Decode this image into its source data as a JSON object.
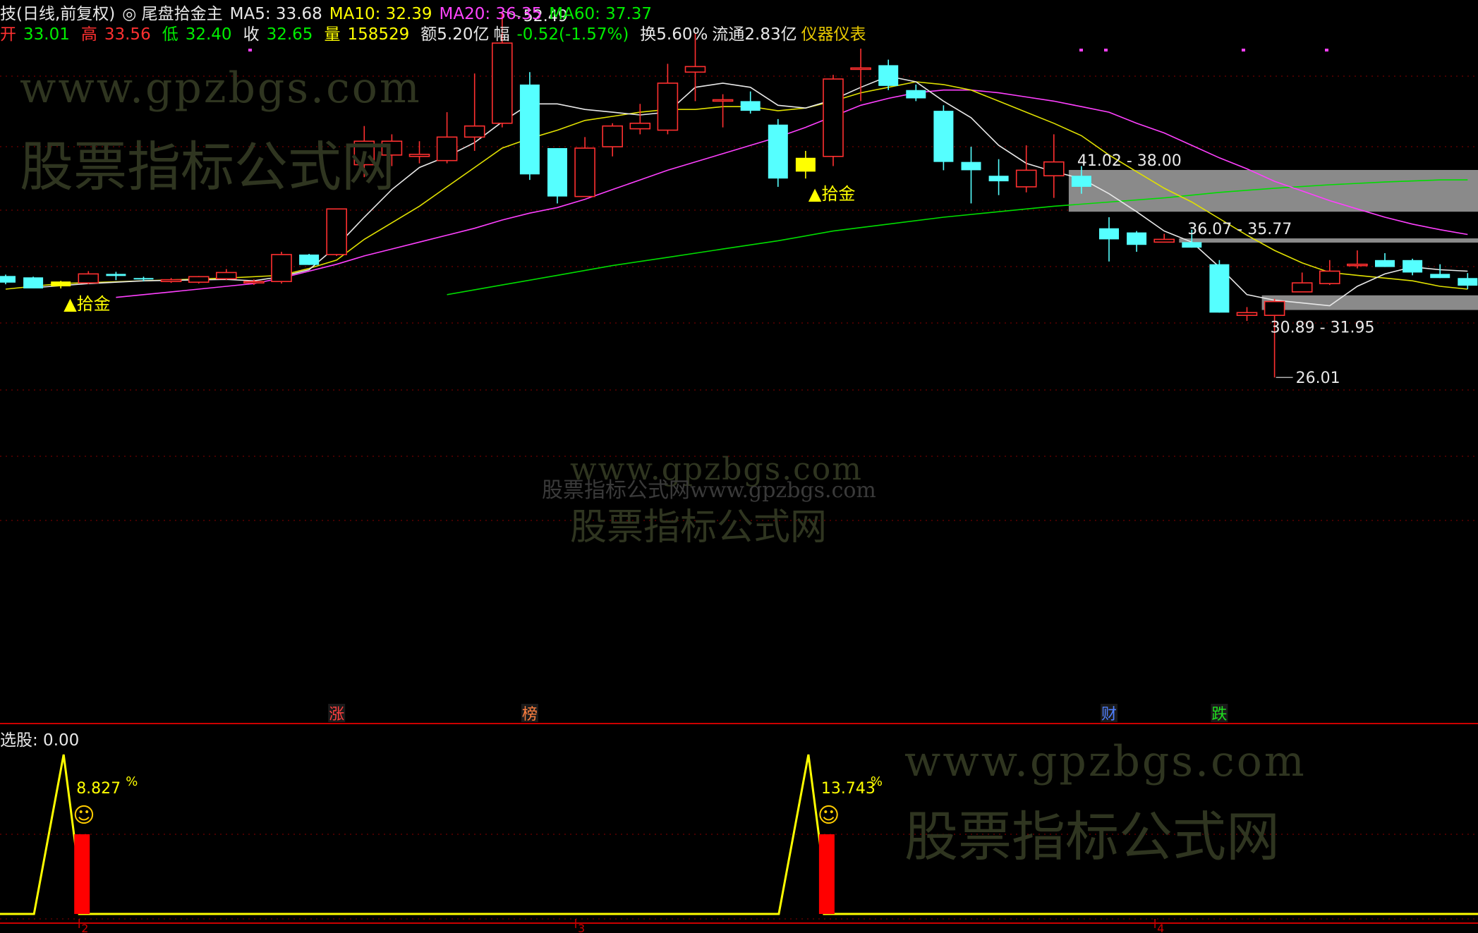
{
  "header": {
    "title_prefix": "技(日线,前复权)",
    "indicator_name": "尾盘拾金主",
    "ma5": "MA5: 33.68",
    "ma10": "MA10: 32.39",
    "ma20": "MA20: 36.35",
    "ma60": "MA60: 37.37",
    "open_label": "开",
    "open": "33.01",
    "high_label": "高",
    "high": "33.56",
    "low_label": "低",
    "low": "32.40",
    "close_label": "收",
    "close": "32.65",
    "vol_label": "量",
    "vol": "158529",
    "amount": "额5.20亿",
    "change_label": "幅",
    "change": "-0.52(-1.57%)",
    "turnover": "换5.60%",
    "float_cap": "流通2.83亿",
    "sector": "仪器仪表"
  },
  "sub_panel": {
    "label": "选股: 0.00"
  },
  "watermarks": {
    "url": "www.gpzbgs.com",
    "name": "股票指标公式网",
    "combined": "股票指标公式网www.gpzbgs.com"
  },
  "colors": {
    "up": "#ff3030",
    "down": "#55ffff",
    "signal": "#ffff00",
    "ma5": "#e8e8e8",
    "ma10": "#e0e000",
    "ma20": "#ff40ff",
    "ma60": "#00dd00",
    "grid": "#8b0000",
    "zone": "#8a8a8a"
  },
  "chart_data": {
    "type": "candlestick",
    "price_axis_visible": false,
    "grid": "dotted-horizontal",
    "candles": [
      {
        "o": 33.35,
        "h": 33.45,
        "l": 32.75,
        "c": 32.87
      },
      {
        "o": 33.25,
        "h": 33.3,
        "l": 32.45,
        "c": 32.45
      },
      {
        "o": 32.6,
        "h": 33.0,
        "l": 32.45,
        "c": 32.95,
        "signal": true
      },
      {
        "o": 32.85,
        "h": 33.7,
        "l": 32.75,
        "c": 33.5
      },
      {
        "o": 33.5,
        "h": 33.65,
        "l": 33.05,
        "c": 33.35
      },
      {
        "o": 33.2,
        "h": 33.3,
        "l": 32.95,
        "c": 33.15
      },
      {
        "o": 32.95,
        "h": 33.2,
        "l": 32.85,
        "c": 33.08
      },
      {
        "o": 32.9,
        "h": 33.35,
        "l": 32.8,
        "c": 33.3
      },
      {
        "o": 33.15,
        "h": 33.85,
        "l": 33.05,
        "c": 33.6
      },
      {
        "o": 32.87,
        "h": 33.1,
        "l": 32.7,
        "c": 32.95
      },
      {
        "o": 32.95,
        "h": 35.1,
        "l": 32.8,
        "c": 34.9
      },
      {
        "o": 34.9,
        "h": 34.95,
        "l": 34.15,
        "c": 34.15
      },
      {
        "o": 34.9,
        "h": 38.2,
        "l": 34.8,
        "c": 38.2
      },
      {
        "o": 41.4,
        "h": 44.2,
        "l": 40.5,
        "c": 43.1
      },
      {
        "o": 42.1,
        "h": 43.6,
        "l": 41.3,
        "c": 43.1
      },
      {
        "o": 42.0,
        "h": 43.1,
        "l": 41.5,
        "c": 42.15
      },
      {
        "o": 41.7,
        "h": 45.2,
        "l": 41.5,
        "c": 43.4
      },
      {
        "o": 43.4,
        "h": 48.0,
        "l": 42.4,
        "c": 44.2
      },
      {
        "o": 44.4,
        "h": 52.49,
        "l": 44.1,
        "c": 50.2
      },
      {
        "o": 47.2,
        "h": 48.1,
        "l": 40.3,
        "c": 40.7
      },
      {
        "o": 42.6,
        "h": 42.6,
        "l": 38.6,
        "c": 39.1
      },
      {
        "o": 39.1,
        "h": 43.4,
        "l": 39.1,
        "c": 42.6
      },
      {
        "o": 42.7,
        "h": 44.4,
        "l": 42.0,
        "c": 44.2
      },
      {
        "o": 44.0,
        "h": 45.8,
        "l": 43.6,
        "c": 44.4
      },
      {
        "o": 43.9,
        "h": 48.7,
        "l": 43.6,
        "c": 47.3
      },
      {
        "o": 48.1,
        "h": 50.9,
        "l": 46.0,
        "c": 48.5
      },
      {
        "o": 46.1,
        "h": 46.5,
        "l": 44.1,
        "c": 46.1
      },
      {
        "o": 46.0,
        "h": 46.7,
        "l": 45.1,
        "c": 45.3
      },
      {
        "o": 44.3,
        "h": 44.7,
        "l": 39.8,
        "c": 40.4
      },
      {
        "o": 40.9,
        "h": 42.4,
        "l": 40.4,
        "c": 41.9,
        "signal": true
      },
      {
        "o": 42.0,
        "h": 47.9,
        "l": 41.3,
        "c": 47.6
      },
      {
        "o": 48.4,
        "h": 49.8,
        "l": 46.0,
        "c": 48.4
      },
      {
        "o": 48.6,
        "h": 49.0,
        "l": 46.8,
        "c": 47.1
      },
      {
        "o": 46.8,
        "h": 47.2,
        "l": 46.0,
        "c": 46.2
      },
      {
        "o": 45.3,
        "h": 45.7,
        "l": 41.0,
        "c": 41.6
      },
      {
        "o": 41.6,
        "h": 42.7,
        "l": 38.6,
        "c": 41.0
      },
      {
        "o": 40.6,
        "h": 41.8,
        "l": 39.2,
        "c": 40.2
      },
      {
        "o": 39.8,
        "h": 42.8,
        "l": 39.4,
        "c": 41.0
      },
      {
        "o": 40.6,
        "h": 43.6,
        "l": 39.0,
        "c": 41.6
      },
      {
        "o": 40.6,
        "h": 41.3,
        "l": 39.3,
        "c": 39.8
      },
      {
        "o": 36.8,
        "h": 37.6,
        "l": 34.4,
        "c": 36.0
      },
      {
        "o": 36.5,
        "h": 36.6,
        "l": 35.1,
        "c": 35.6
      },
      {
        "o": 35.8,
        "h": 36.4,
        "l": 35.8,
        "c": 36.0
      },
      {
        "o": 35.8,
        "h": 36.7,
        "l": 35.4,
        "c": 35.4
      },
      {
        "o": 34.2,
        "h": 34.5,
        "l": 30.7,
        "c": 30.7
      },
      {
        "o": 30.5,
        "h": 31.1,
        "l": 30.1,
        "c": 30.7
      },
      {
        "o": 30.5,
        "h": 31.7,
        "l": 26.01,
        "c": 31.5
      },
      {
        "o": 32.2,
        "h": 33.6,
        "l": 32.2,
        "c": 32.85
      },
      {
        "o": 32.8,
        "h": 34.5,
        "l": 32.7,
        "c": 33.7
      },
      {
        "o": 34.2,
        "h": 35.2,
        "l": 33.9,
        "c": 34.2
      },
      {
        "o": 34.5,
        "h": 35.0,
        "l": 34.0,
        "c": 34.0
      },
      {
        "o": 34.5,
        "h": 34.6,
        "l": 33.4,
        "c": 33.6
      },
      {
        "o": 33.5,
        "h": 34.2,
        "l": 33.2,
        "c": 33.2
      },
      {
        "o": 33.2,
        "h": 33.56,
        "l": 32.4,
        "c": 32.65
      }
    ],
    "ma5": {
      "name": "MA5",
      "points": [
        [
          1,
          32.5
        ],
        [
          3,
          32.8
        ],
        [
          5,
          33.0
        ],
        [
          8,
          33.1
        ],
        [
          9,
          33.0
        ],
        [
          10,
          33.3
        ],
        [
          11,
          33.8
        ],
        [
          12,
          35.5
        ],
        [
          13,
          37.6
        ],
        [
          14,
          39.6
        ],
        [
          15,
          41.2
        ],
        [
          16,
          42.0
        ],
        [
          17,
          43.0
        ],
        [
          18,
          44.5
        ],
        [
          19,
          45.8
        ],
        [
          20,
          45.8
        ],
        [
          21,
          45.4
        ],
        [
          22,
          45.2
        ],
        [
          23,
          45.0
        ],
        [
          24,
          45.2
        ],
        [
          25,
          47.0
        ],
        [
          26,
          47.3
        ],
        [
          27,
          47.0
        ],
        [
          28,
          45.7
        ],
        [
          29,
          45.5
        ],
        [
          30,
          46.1
        ],
        [
          31,
          47.0
        ],
        [
          32,
          47.8
        ],
        [
          33,
          47.4
        ],
        [
          34,
          46.0
        ],
        [
          35,
          44.8
        ],
        [
          36,
          42.8
        ],
        [
          37,
          41.5
        ],
        [
          38,
          40.9
        ],
        [
          39,
          40.4
        ],
        [
          40,
          39.3
        ],
        [
          41,
          38.0
        ],
        [
          42,
          36.6
        ],
        [
          43,
          35.8
        ],
        [
          44,
          34.0
        ],
        [
          45,
          32.0
        ],
        [
          46,
          31.6
        ],
        [
          47,
          31.4
        ],
        [
          48,
          31.2
        ],
        [
          49,
          32.6
        ],
        [
          50,
          33.5
        ],
        [
          51,
          34.0
        ],
        [
          52,
          33.8
        ],
        [
          53,
          33.7
        ]
      ]
    },
    "ma10": {
      "name": "MA10",
      "points": [
        [
          0,
          32.4
        ],
        [
          2,
          32.8
        ],
        [
          5,
          33.0
        ],
        [
          8,
          33.2
        ],
        [
          10,
          33.4
        ],
        [
          11,
          33.9
        ],
        [
          12,
          34.5
        ],
        [
          13,
          36.0
        ],
        [
          14,
          37.2
        ],
        [
          15,
          38.4
        ],
        [
          16,
          39.8
        ],
        [
          17,
          41.2
        ],
        [
          18,
          42.6
        ],
        [
          19,
          43.3
        ],
        [
          20,
          43.9
        ],
        [
          21,
          44.6
        ],
        [
          22,
          44.9
        ],
        [
          23,
          45.2
        ],
        [
          24,
          45.4
        ],
        [
          25,
          45.4
        ],
        [
          26,
          45.6
        ],
        [
          27,
          45.6
        ],
        [
          28,
          45.3
        ],
        [
          29,
          45.5
        ],
        [
          30,
          46.0
        ],
        [
          31,
          46.6
        ],
        [
          32,
          47.0
        ],
        [
          33,
          47.4
        ],
        [
          34,
          47.2
        ],
        [
          35,
          46.8
        ],
        [
          36,
          46.0
        ],
        [
          37,
          45.2
        ],
        [
          38,
          44.4
        ],
        [
          39,
          43.5
        ],
        [
          40,
          42.1
        ],
        [
          41,
          40.9
        ],
        [
          42,
          39.7
        ],
        [
          43,
          38.7
        ],
        [
          44,
          37.5
        ],
        [
          45,
          36.3
        ],
        [
          46,
          35.2
        ],
        [
          47,
          34.3
        ],
        [
          48,
          33.6
        ],
        [
          49,
          33.4
        ],
        [
          50,
          33.2
        ],
        [
          51,
          33.0
        ],
        [
          52,
          32.6
        ],
        [
          53,
          32.4
        ]
      ]
    },
    "ma20": {
      "name": "MA20",
      "points": [
        [
          4,
          31.8
        ],
        [
          6,
          32.2
        ],
        [
          8,
          32.6
        ],
        [
          9,
          32.8
        ],
        [
          10,
          33.2
        ],
        [
          11,
          33.7
        ],
        [
          12,
          34.2
        ],
        [
          13,
          34.8
        ],
        [
          14,
          35.3
        ],
        [
          15,
          35.8
        ],
        [
          16,
          36.3
        ],
        [
          17,
          36.8
        ],
        [
          18,
          37.4
        ],
        [
          19,
          37.9
        ],
        [
          20,
          38.3
        ],
        [
          21,
          38.9
        ],
        [
          22,
          39.6
        ],
        [
          23,
          40.3
        ],
        [
          24,
          41.0
        ],
        [
          25,
          41.6
        ],
        [
          26,
          42.2
        ],
        [
          27,
          42.8
        ],
        [
          28,
          43.4
        ],
        [
          29,
          44.1
        ],
        [
          30,
          44.9
        ],
        [
          31,
          45.7
        ],
        [
          32,
          46.2
        ],
        [
          33,
          46.6
        ],
        [
          34,
          46.8
        ],
        [
          35,
          46.8
        ],
        [
          36,
          46.6
        ],
        [
          37,
          46.3
        ],
        [
          38,
          46.0
        ],
        [
          39,
          45.6
        ],
        [
          40,
          45.2
        ],
        [
          41,
          44.4
        ],
        [
          42,
          43.7
        ],
        [
          43,
          42.8
        ],
        [
          44,
          41.9
        ],
        [
          45,
          41.1
        ],
        [
          46,
          40.2
        ],
        [
          47,
          39.5
        ],
        [
          48,
          38.8
        ],
        [
          49,
          38.2
        ],
        [
          50,
          37.6
        ],
        [
          51,
          37.1
        ],
        [
          52,
          36.7
        ],
        [
          53,
          36.35
        ]
      ]
    },
    "ma60": {
      "name": "MA60",
      "points": [
        [
          16,
          32.0
        ],
        [
          18,
          32.7
        ],
        [
          20,
          33.4
        ],
        [
          22,
          34.1
        ],
        [
          24,
          34.7
        ],
        [
          26,
          35.3
        ],
        [
          28,
          35.9
        ],
        [
          30,
          36.6
        ],
        [
          32,
          37.1
        ],
        [
          34,
          37.6
        ],
        [
          36,
          38.0
        ],
        [
          38,
          38.4
        ],
        [
          40,
          38.7
        ],
        [
          42,
          39.0
        ],
        [
          44,
          39.4
        ],
        [
          46,
          39.7
        ],
        [
          48,
          39.95
        ],
        [
          50,
          40.15
        ],
        [
          52,
          40.3
        ],
        [
          53,
          40.3
        ]
      ]
    },
    "zones": [
      {
        "label": "41.02 - 38.00",
        "high": 41.02,
        "low": 38.0,
        "from": 39
      },
      {
        "label": "36.07 - 35.77",
        "high": 36.07,
        "low": 35.77,
        "from": 43
      },
      {
        "label": "30.89 - 31.95",
        "high": 31.95,
        "low": 30.89,
        "from": 46
      }
    ],
    "annotations": [
      {
        "text": "52.49",
        "index": 18,
        "price": 52.49,
        "type": "high"
      },
      {
        "text": "26.01",
        "index": 46,
        "price": 26.01,
        "type": "low"
      }
    ],
    "signal_text": "▲拾金",
    "event_markers": [
      {
        "index": 12,
        "text": "涨",
        "color": "#ff4040"
      },
      {
        "index": 19,
        "text": "榜",
        "color": "#ff8040"
      },
      {
        "index": 40,
        "text": "财",
        "color": "#5080ff"
      },
      {
        "index": 44,
        "text": "跌",
        "color": "#20e020"
      }
    ],
    "indicator": {
      "signals": [
        {
          "index": 2,
          "label": "8.827",
          "unit": "%",
          "icon": "☺"
        },
        {
          "index": 29,
          "label": "13.743",
          "unit": "%",
          "icon": "☺"
        }
      ],
      "month_labels": [
        {
          "index": 2,
          "text": "2"
        },
        {
          "index": 20,
          "text": "3"
        },
        {
          "index": 41,
          "text": "4"
        }
      ]
    }
  }
}
